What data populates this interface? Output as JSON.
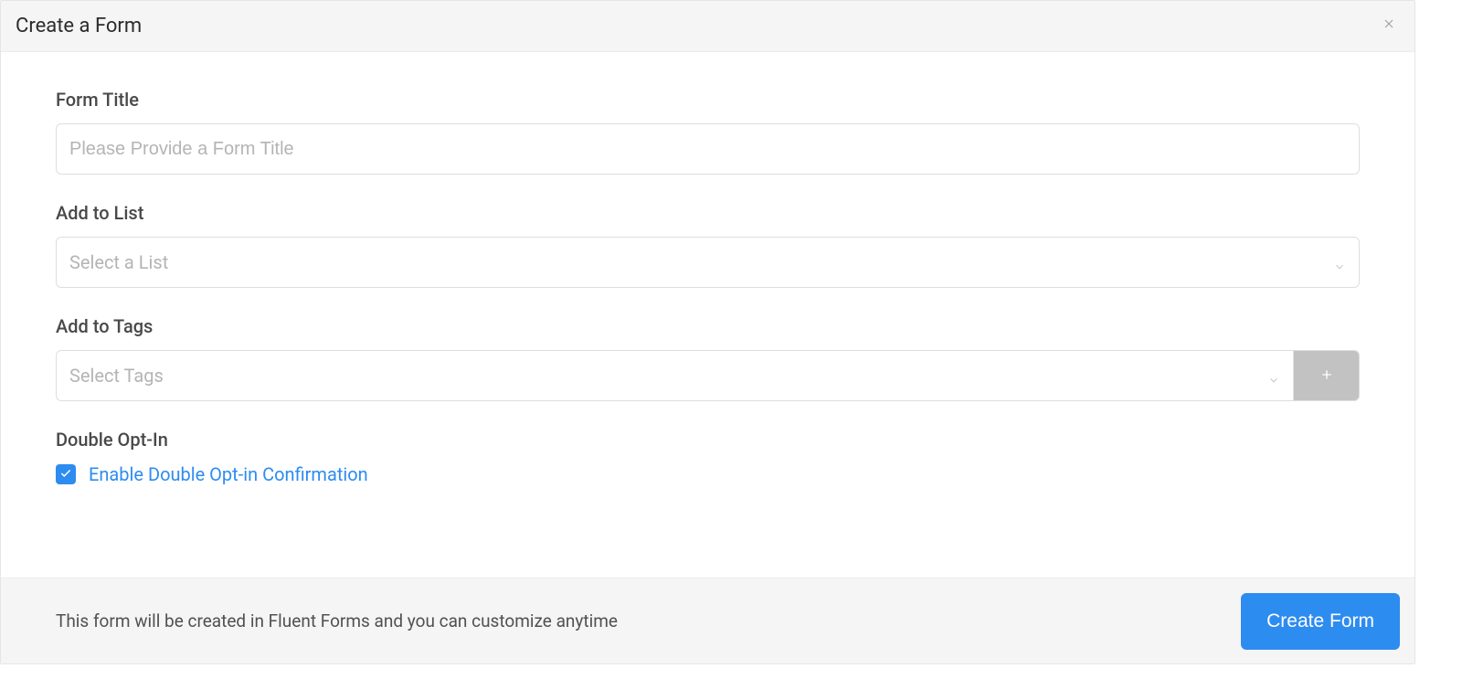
{
  "dialog": {
    "title": "Create a Form"
  },
  "form": {
    "title_label": "Form Title",
    "title_placeholder": "Please Provide a Form Title",
    "title_value": "",
    "list_label": "Add to List",
    "list_placeholder": "Select a List",
    "tags_label": "Add to Tags",
    "tags_placeholder": "Select Tags",
    "optin_label": "Double Opt-In",
    "optin_checkbox_label": "Enable Double Opt-in Confirmation",
    "optin_checked": true
  },
  "footer": {
    "note": "This form will be created in Fluent Forms and you can customize anytime",
    "submit_label": "Create Form"
  },
  "icons": {
    "close": "close-icon",
    "chevron_down": "chevron-down-icon",
    "plus": "plus-icon",
    "check": "check-icon"
  }
}
